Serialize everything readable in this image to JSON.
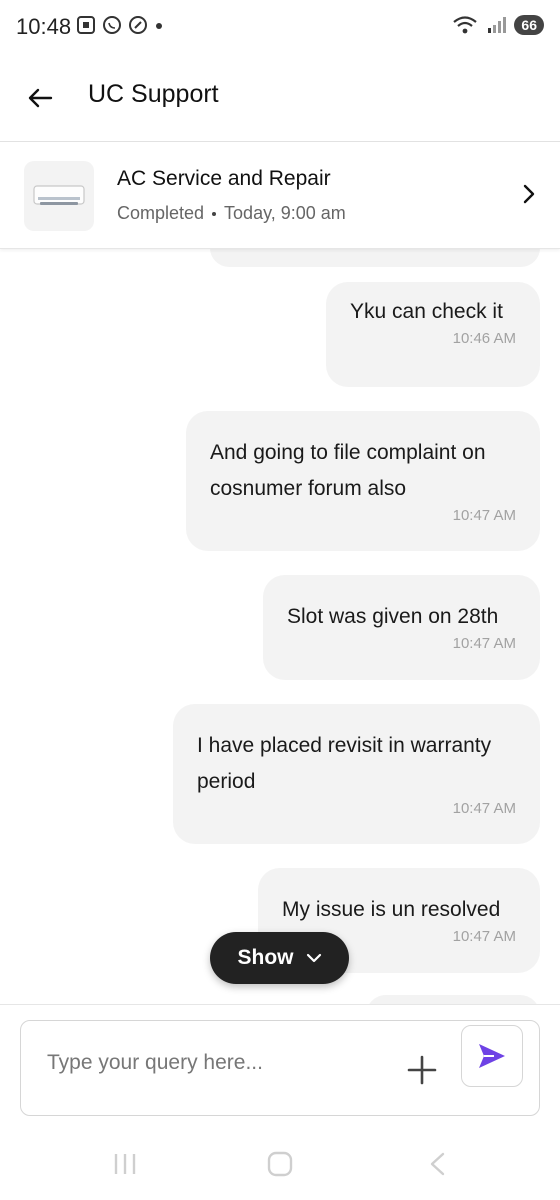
{
  "status_bar": {
    "time": "10:48",
    "battery": "66"
  },
  "header": {
    "title": "UC Support"
  },
  "booking": {
    "service_name": "AC Service and Repair",
    "status": "Completed",
    "datetime": "Today, 9:00 am"
  },
  "messages": [
    {
      "lines": [
        "Yku can check it"
      ],
      "time": "10:46 AM"
    },
    {
      "lines": [
        "And going to file complaint on",
        "cosnumer forum also"
      ],
      "time": "10:47 AM"
    },
    {
      "lines": [
        "Slot was given on 28th"
      ],
      "time": "10:47 AM"
    },
    {
      "lines": [
        "I have placed revisit in warranty",
        "period"
      ],
      "time": "10:47 AM"
    },
    {
      "lines": [
        "My issue is un resolved"
      ],
      "time": "10:47 AM"
    }
  ],
  "show_pill": {
    "label": "Show"
  },
  "composer": {
    "placeholder": "Type your query here..."
  },
  "colors": {
    "send_accent": "#6e42e5",
    "bubble_bg": "#f3f3f3"
  },
  "icons": {
    "back": "arrow-left-icon",
    "chevron": "chevron-right-icon",
    "attach": "plus-icon",
    "send": "send-icon"
  }
}
